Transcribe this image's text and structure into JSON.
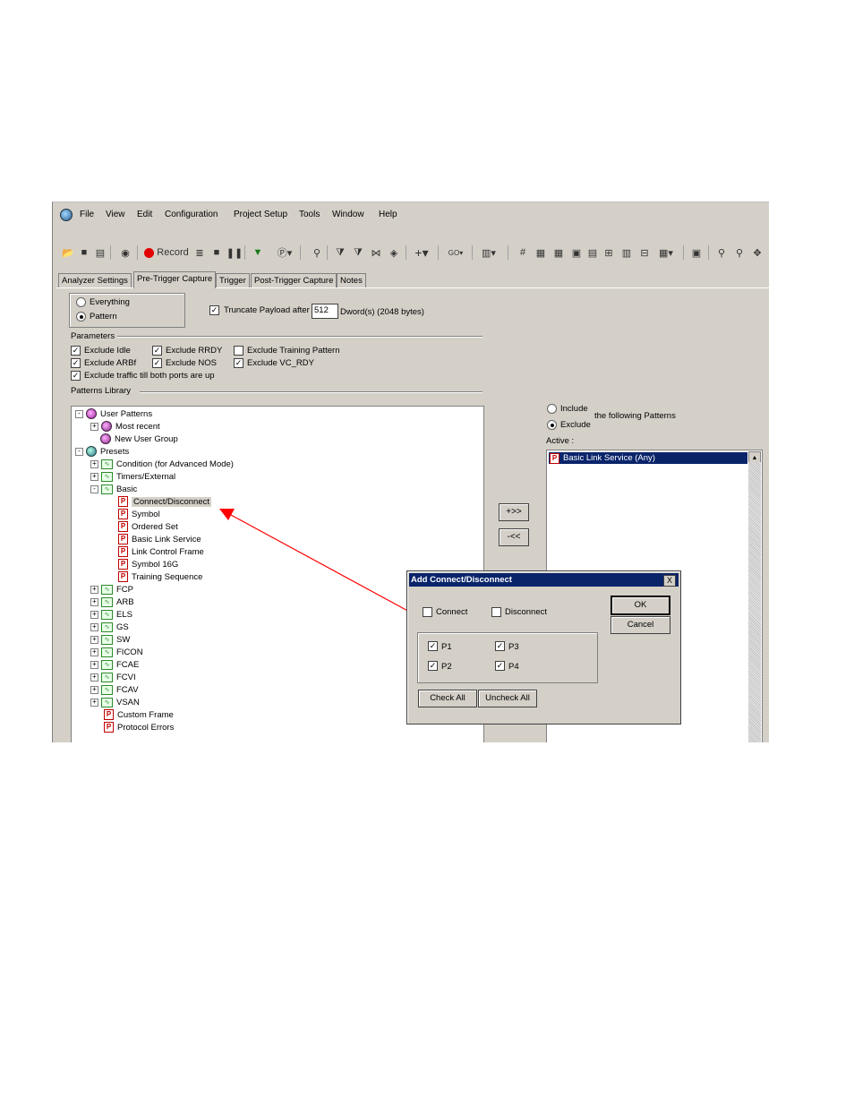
{
  "menu": [
    "File",
    "View",
    "Edit",
    "Configuration",
    "Project Setup",
    "Tools",
    "Window",
    "Help"
  ],
  "toolbar": {
    "record_label": "Record"
  },
  "tabs": [
    "Analyzer Settings",
    "Pre-Trigger Capture",
    "Trigger",
    "Post-Trigger Capture",
    "Notes"
  ],
  "capture_mode": {
    "options": [
      "Everything",
      "Pattern"
    ],
    "selected": "Pattern"
  },
  "truncate": {
    "label": "Truncate Payload after",
    "value": "512",
    "suffix": "Dword(s) (2048 bytes)"
  },
  "parameters": {
    "title": "Parameters",
    "items": [
      {
        "label": "Exclude Idle",
        "checked": true
      },
      {
        "label": "Exclude RRDY",
        "checked": true
      },
      {
        "label": "Exclude Training Pattern",
        "checked": false
      },
      {
        "label": "Exclude ARBf",
        "checked": true
      },
      {
        "label": "Exclude NOS",
        "checked": true
      },
      {
        "label": "Exclude VC_RDY",
        "checked": true
      },
      {
        "label": "Exclude traffic till both ports are up",
        "checked": true
      }
    ]
  },
  "patterns_library": {
    "title": "Patterns Library",
    "tree": [
      {
        "label": "User Patterns",
        "level": 0,
        "icon": "user-icon",
        "exp": "-"
      },
      {
        "label": "Most recent",
        "level": 1,
        "icon": "group-icon",
        "exp": "+"
      },
      {
        "label": "New User Group",
        "level": 1,
        "icon": "group-icon",
        "exp": ""
      },
      {
        "label": "Presets",
        "level": 0,
        "icon": "globe-icon",
        "exp": "-"
      },
      {
        "label": "Condition (for Advanced Mode)",
        "level": 1,
        "icon": "wave-icon",
        "exp": "+"
      },
      {
        "label": "Timers/External",
        "level": 1,
        "icon": "wave-icon",
        "exp": "+"
      },
      {
        "label": "Basic",
        "level": 1,
        "icon": "wave-icon",
        "exp": "-"
      },
      {
        "label": "Connect/Disconnect",
        "level": 2,
        "icon": "pattern-icon",
        "exp": "",
        "selected": true
      },
      {
        "label": "Symbol",
        "level": 2,
        "icon": "pattern-icon",
        "exp": ""
      },
      {
        "label": "Ordered Set",
        "level": 2,
        "icon": "pattern-icon",
        "exp": ""
      },
      {
        "label": "Basic Link Service",
        "level": 2,
        "icon": "pattern-icon",
        "exp": ""
      },
      {
        "label": "Link Control Frame",
        "level": 2,
        "icon": "pattern-icon",
        "exp": ""
      },
      {
        "label": "Symbol 16G",
        "level": 2,
        "icon": "pattern-icon",
        "exp": ""
      },
      {
        "label": "Training Sequence",
        "level": 2,
        "icon": "pattern-icon",
        "exp": ""
      },
      {
        "label": "FCP",
        "level": 1,
        "icon": "wave-icon",
        "exp": "+"
      },
      {
        "label": "ARB",
        "level": 1,
        "icon": "wave-icon",
        "exp": "+"
      },
      {
        "label": "ELS",
        "level": 1,
        "icon": "wave-icon",
        "exp": "+"
      },
      {
        "label": "GS",
        "level": 1,
        "icon": "wave-icon",
        "exp": "+"
      },
      {
        "label": "SW",
        "level": 1,
        "icon": "wave-icon",
        "exp": "+"
      },
      {
        "label": "FICON",
        "level": 1,
        "icon": "wave-icon",
        "exp": "+"
      },
      {
        "label": "FCAE",
        "level": 1,
        "icon": "wave-icon",
        "exp": "+"
      },
      {
        "label": "FCVI",
        "level": 1,
        "icon": "wave-icon",
        "exp": "+"
      },
      {
        "label": "FCAV",
        "level": 1,
        "icon": "wave-icon",
        "exp": "+"
      },
      {
        "label": "VSAN",
        "level": 1,
        "icon": "wave-icon",
        "exp": "+"
      },
      {
        "label": "Custom Frame",
        "level": 1,
        "icon": "pattern-icon",
        "exp": ""
      },
      {
        "label": "Protocol Errors",
        "level": 1,
        "icon": "pattern-icon",
        "exp": ""
      }
    ]
  },
  "transfer_buttons": {
    "add": "+>>",
    "remove": "-<<"
  },
  "filter_mode": {
    "include": "Include",
    "exclude": "Exclude",
    "suffix": "the following Patterns",
    "selected": "Exclude"
  },
  "active": {
    "label": "Active :",
    "items": [
      "Basic Link Service (Any)"
    ]
  },
  "dialog": {
    "title": "Add Connect/Disconnect",
    "connect": {
      "label": "Connect",
      "checked": false
    },
    "disconnect": {
      "label": "Disconnect",
      "checked": false
    },
    "ports": [
      {
        "label": "P1",
        "checked": true
      },
      {
        "label": "P3",
        "checked": true
      },
      {
        "label": "P2",
        "checked": true
      },
      {
        "label": "P4",
        "checked": true
      }
    ],
    "check_all": "Check All",
    "uncheck_all": "Uncheck All",
    "ok": "OK",
    "cancel": "Cancel",
    "close": "X"
  },
  "colors": {
    "title_bar": "#0a246a",
    "annotation_arrow": "#ff0000",
    "window_bg": "#d4d0c8"
  }
}
